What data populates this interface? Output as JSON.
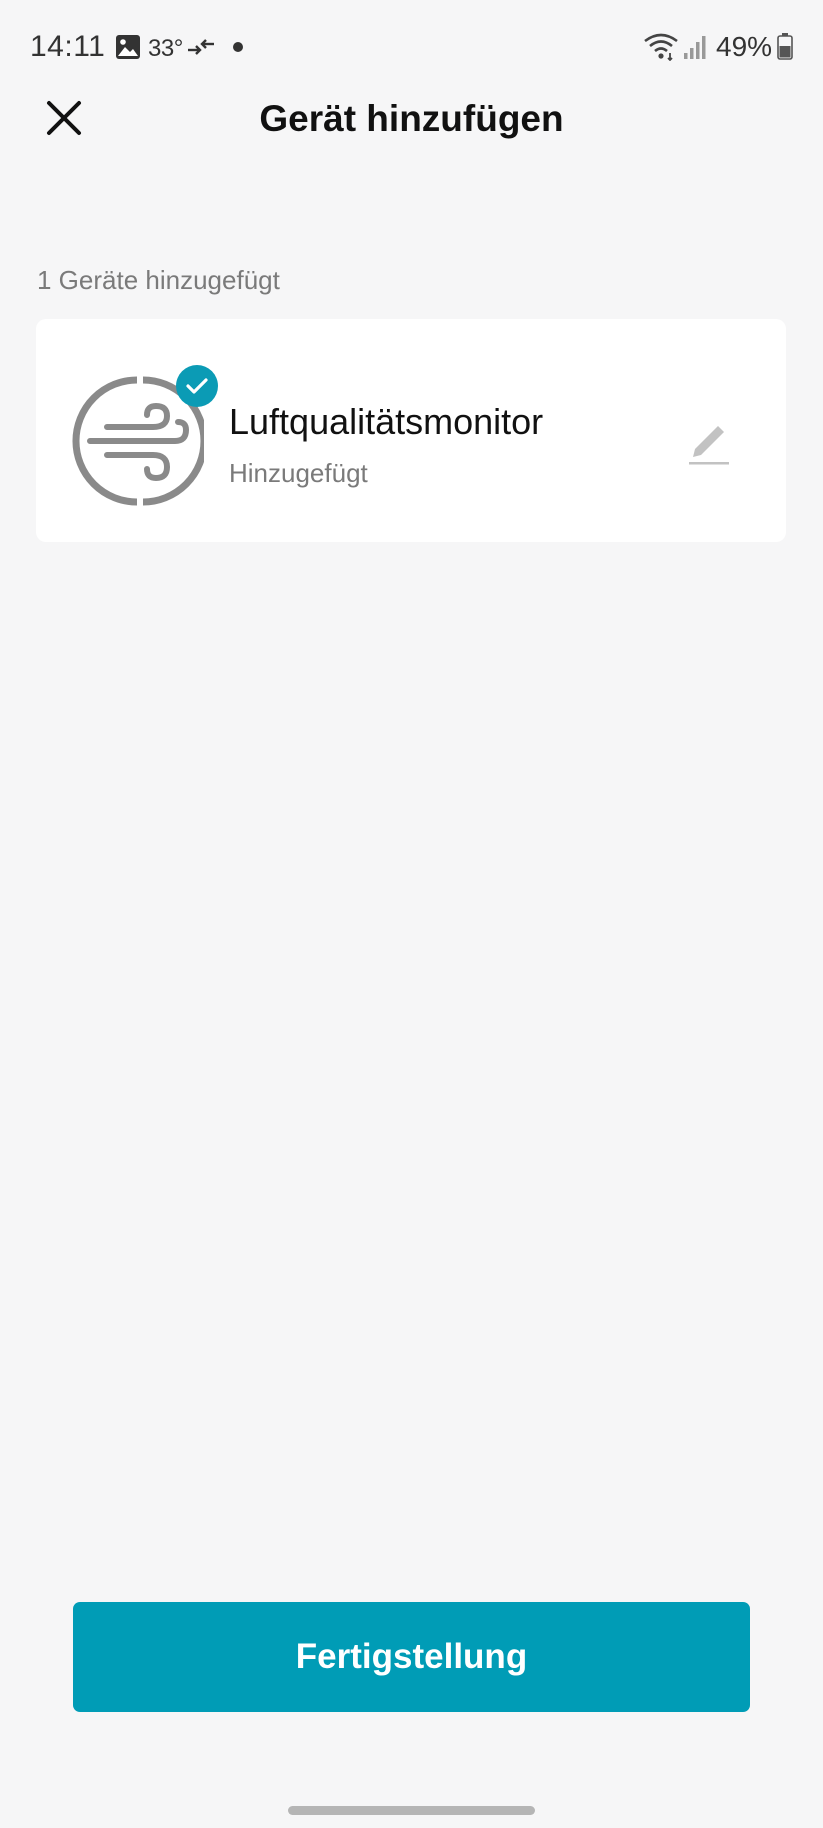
{
  "status_bar": {
    "time": "14:11",
    "temperature": "33°",
    "battery": "49%",
    "icons": [
      "gallery-icon",
      "data-transfer-icon",
      "notification-dot-icon",
      "wifi-icon",
      "signal-icon",
      "battery-icon"
    ]
  },
  "header": {
    "title": "Gerät hinzufügen",
    "close_icon": "close-icon"
  },
  "device_list": {
    "count_label": "1 Geräte hinzugefügt",
    "items": [
      {
        "name": "Luftqualitätsmonitor",
        "status": "Hinzugefügt",
        "icon": "air-quality-icon",
        "badge_icon": "checkmark-icon",
        "action_icon": "edit-icon"
      }
    ]
  },
  "footer": {
    "finish_label": "Fertigstellung"
  },
  "colors": {
    "accent": "#009cb6",
    "badge": "#0b9bb5",
    "background": "#f6f6f7",
    "card": "#ffffff",
    "secondary_text": "#7a7a7a"
  }
}
